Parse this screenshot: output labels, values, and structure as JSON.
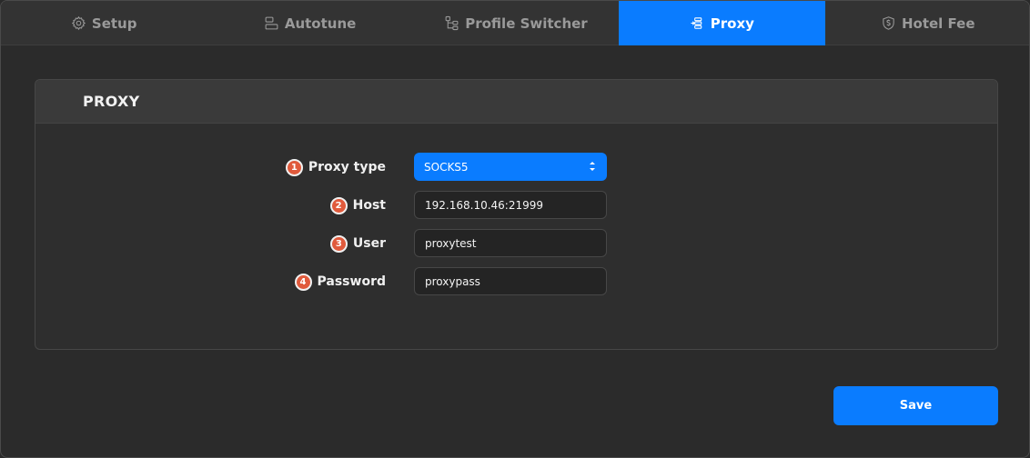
{
  "tabs": [
    {
      "label": "Setup",
      "icon": "gear-icon"
    },
    {
      "label": "Autotune",
      "icon": "layout-icon"
    },
    {
      "label": "Profile Switcher",
      "icon": "tree-icon"
    },
    {
      "label": "Proxy",
      "icon": "proxy-icon",
      "active": true
    },
    {
      "label": "Hotel Fee",
      "icon": "shield-dollar-icon"
    }
  ],
  "panel": {
    "title": "PROXY"
  },
  "form": {
    "proxy_type": {
      "badge": "1",
      "label": "Proxy type",
      "value": "SOCKS5"
    },
    "host": {
      "badge": "2",
      "label": "Host",
      "value": "192.168.10.46:21999"
    },
    "user": {
      "badge": "3",
      "label": "User",
      "value": "proxytest"
    },
    "password": {
      "badge": "4",
      "label": "Password",
      "value": "proxypass"
    }
  },
  "save_label": "Save",
  "colors": {
    "accent": "#0a7cff",
    "badge": "#e05a3c",
    "background": "#2b2b2b"
  }
}
